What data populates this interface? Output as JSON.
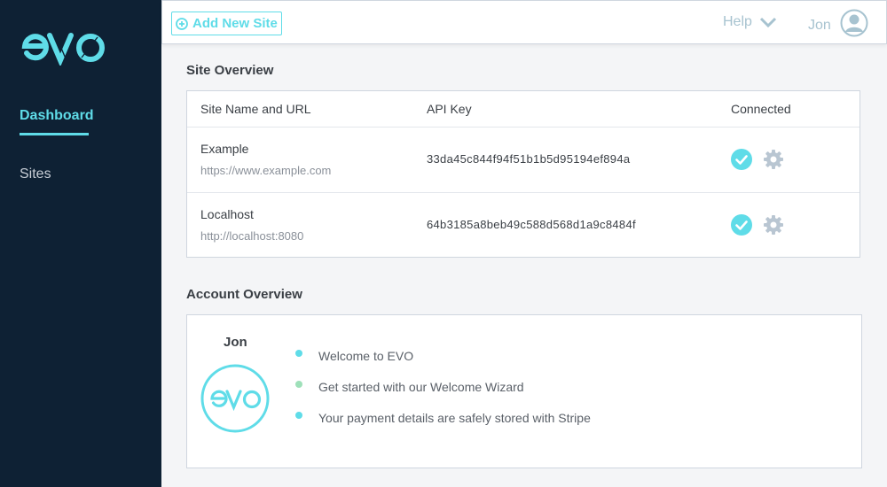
{
  "brand": {
    "logo_text": "evo"
  },
  "sidebar": {
    "items": [
      {
        "label": "Dashboard",
        "active": true
      },
      {
        "label": "Sites",
        "active": false
      }
    ]
  },
  "topbar": {
    "add_label": "Add New Site",
    "help_label": "Help",
    "user_name": "Jon"
  },
  "site_overview": {
    "title": "Site Overview",
    "columns": [
      "Site Name and URL",
      "API Key",
      "Connected"
    ],
    "rows": [
      {
        "name": "Example",
        "url": "https://www.example.com",
        "api_key": "33da45c844f94f51b1b5d95194ef894a",
        "connected": true
      },
      {
        "name": "Localhost",
        "url": "http://localhost:8080",
        "api_key": "64b3185a8beb49c588d568d1a9c8484f",
        "connected": true
      }
    ]
  },
  "account_overview": {
    "title": "Account Overview",
    "name": "Jon",
    "bullets": [
      {
        "text": "Welcome to EVO",
        "color": "#5fdce8"
      },
      {
        "text": "Get started with our Welcome Wizard",
        "color": "#9ee0b9"
      },
      {
        "text": "Your payment details are safely stored with Stripe",
        "color": "#5fdce8"
      }
    ]
  },
  "colors": {
    "accent": "#5fdce8",
    "sidebar_bg": "#0e2134",
    "muted": "#a7c3d0"
  }
}
